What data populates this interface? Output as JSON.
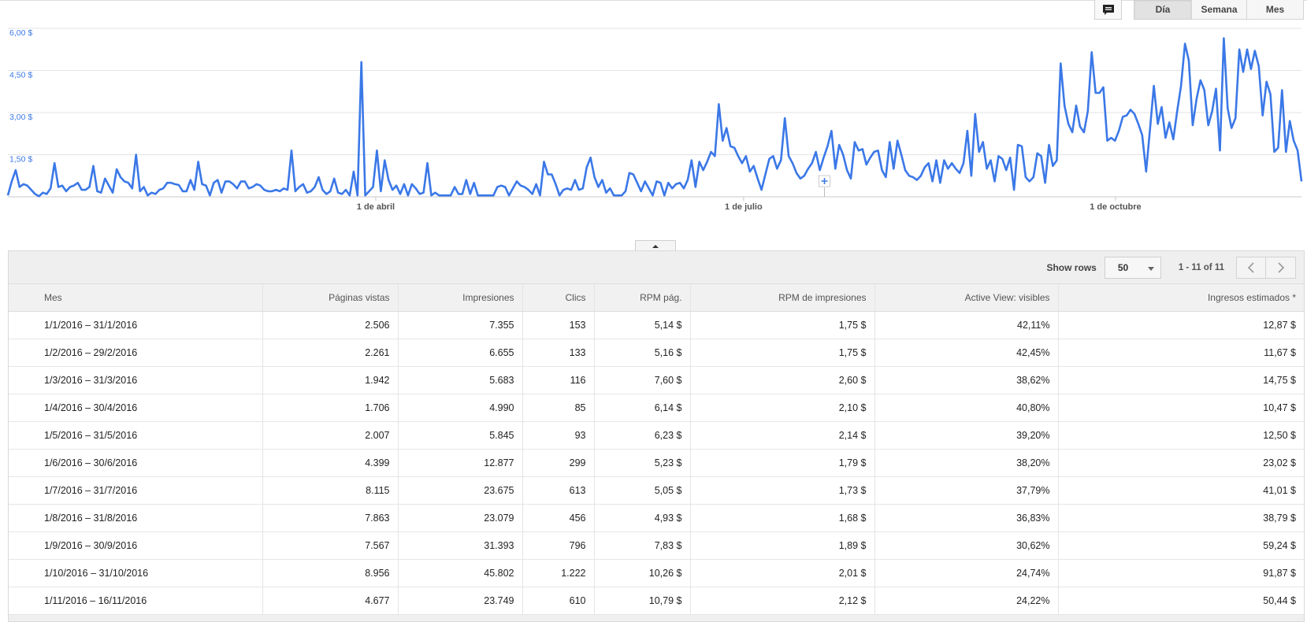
{
  "view_toggle": {
    "options": [
      "Día",
      "Semana",
      "Mes"
    ],
    "active": "Día",
    "annotation_icon": "comment-icon"
  },
  "chart_data": {
    "type": "line",
    "title": "",
    "xlabel": "",
    "ylabel": "",
    "x_start": "2016-01-01",
    "x_end": "2016-11-16",
    "x_tick_labels": [
      "1 de abril",
      "1 de julio",
      "1 de octubre"
    ],
    "y_tick_labels": [
      "1,50 $",
      "3,00 $",
      "4,50 $",
      "6,00 $"
    ],
    "ylim": [
      0,
      6
    ],
    "grid": true,
    "color": "#3b78e7",
    "series": [
      {
        "values": [
          0.05,
          0.55,
          0.95,
          0.35,
          0.45,
          0.4,
          0.25,
          0.1,
          0.02,
          0.15,
          0.1,
          0.3,
          1.2,
          0.35,
          0.4,
          0.2,
          0.35,
          0.4,
          0.5,
          0.25,
          0.25,
          0.35,
          1.1,
          0.2,
          0.15,
          0.65,
          0.4,
          0.15,
          0.98,
          0.7,
          0.55,
          0.5,
          0.3,
          1.5,
          0.2,
          0.35,
          0.05,
          0.15,
          0.1,
          0.25,
          0.3,
          0.5,
          0.5,
          0.45,
          0.42,
          0.2,
          0.2,
          0.6,
          0.25,
          1.25,
          0.45,
          0.4,
          0.05,
          0.5,
          0.6,
          0.15,
          0.55,
          0.55,
          0.45,
          0.3,
          0.55,
          0.55,
          0.3,
          0.35,
          0.45,
          0.4,
          0.25,
          0.2,
          0.2,
          0.25,
          0.2,
          0.3,
          0.25,
          1.65,
          0.2,
          0.35,
          0.45,
          0.15,
          0.2,
          0.35,
          0.7,
          0.25,
          0.1,
          0.2,
          0.65,
          0.15,
          0.1,
          0.25,
          0.05,
          0.9,
          0.05,
          4.8,
          0.05,
          0.2,
          0.35,
          1.65,
          0.2,
          1.3,
          0.6,
          0.25,
          0.4,
          0.1,
          0.45,
          0.05,
          0.45,
          0.3,
          0.1,
          0.15,
          1.2,
          0.05,
          0.15,
          0.05,
          0.05,
          0.05,
          0.05,
          0.35,
          0.1,
          0.1,
          0.6,
          0.1,
          0.5,
          0.05,
          0.05,
          0.05,
          0.05,
          0.05,
          0.35,
          0.4,
          0.35,
          0.05,
          0.3,
          0.55,
          0.4,
          0.35,
          0.25,
          0.1,
          0.45,
          0.05,
          1.25,
          0.8,
          0.8,
          0.45,
          0.05,
          0.25,
          0.3,
          0.25,
          0.6,
          0.25,
          0.3,
          1.05,
          1.4,
          0.7,
          0.35,
          0.6,
          0.15,
          0.3,
          0.05,
          0.05,
          0.05,
          0.2,
          0.85,
          0.8,
          0.5,
          0.2,
          0.55,
          0.3,
          0.05,
          0.55,
          0.5,
          0.05,
          0.5,
          0.3,
          0.45,
          0.5,
          0.3,
          0.6,
          1.3,
          0.35,
          1.25,
          0.95,
          1.25,
          1.6,
          1.45,
          3.3,
          2.0,
          2.45,
          1.8,
          1.75,
          1.45,
          1.2,
          1.45,
          0.9,
          1.1,
          0.65,
          0.25,
          0.8,
          1.35,
          1.45,
          1.0,
          1.3,
          2.8,
          1.45,
          1.2,
          0.85,
          0.65,
          0.75,
          1.0,
          1.2,
          1.6,
          0.95,
          1.4,
          1.8,
          2.35,
          1.0,
          1.85,
          1.5,
          0.95,
          0.65,
          1.95,
          1.65,
          1.7,
          1.15,
          1.4,
          1.6,
          1.65,
          0.95,
          0.7,
          1.95,
          1.0,
          2.0,
          1.5,
          0.95,
          0.75,
          0.7,
          0.6,
          0.75,
          1.05,
          1.2,
          0.55,
          1.3,
          0.5,
          1.3,
          1.0,
          1.2,
          1.0,
          0.85,
          1.2,
          2.35,
          0.75,
          2.95,
          1.6,
          1.95,
          1.0,
          1.3,
          0.55,
          1.45,
          1.35,
          0.95,
          1.4,
          0.25,
          1.85,
          1.8,
          0.7,
          0.55,
          0.7,
          1.55,
          1.45,
          0.5,
          1.85,
          1.1,
          1.3,
          4.75,
          3.25,
          2.6,
          2.3,
          3.25,
          2.5,
          2.3,
          3.05,
          5.15,
          3.7,
          3.7,
          3.9,
          2.0,
          2.1,
          2.0,
          2.35,
          2.85,
          2.9,
          3.1,
          2.95,
          2.6,
          2.2,
          0.9,
          2.4,
          3.95,
          2.6,
          3.2,
          2.1,
          2.65,
          2.05,
          3.05,
          3.95,
          5.45,
          4.85,
          2.55,
          3.5,
          4.15,
          3.8,
          2.55,
          3.05,
          3.85,
          1.65,
          5.65,
          3.15,
          2.45,
          2.8,
          5.25,
          4.45,
          5.25,
          4.55,
          5.2,
          4.65,
          2.9,
          4.1,
          3.65,
          1.6,
          1.75,
          3.8,
          1.6,
          2.7,
          2.0,
          1.65,
          0.55
        ]
      }
    ]
  },
  "table": {
    "show_rows_label": "Show rows",
    "rows_value": "50",
    "range_label": "1 - 11 of 11",
    "columns": [
      "Mes",
      "Páginas vistas",
      "Impresiones",
      "Clics",
      "RPM pág.",
      "RPM de impresiones",
      "Active View: visibles",
      "Ingresos estimados *"
    ],
    "rows": [
      [
        "1/1/2016 – 31/1/2016",
        "2.506",
        "7.355",
        "153",
        "5,14 $",
        "1,75 $",
        "42,11%",
        "12,87 $"
      ],
      [
        "1/2/2016 – 29/2/2016",
        "2.261",
        "6.655",
        "133",
        "5,16 $",
        "1,75 $",
        "42,45%",
        "11,67 $"
      ],
      [
        "1/3/2016 – 31/3/2016",
        "1.942",
        "5.683",
        "116",
        "7,60 $",
        "2,60 $",
        "38,62%",
        "14,75 $"
      ],
      [
        "1/4/2016 – 30/4/2016",
        "1.706",
        "4.990",
        "85",
        "6,14 $",
        "2,10 $",
        "40,80%",
        "10,47 $"
      ],
      [
        "1/5/2016 – 31/5/2016",
        "2.007",
        "5.845",
        "93",
        "6,23 $",
        "2,14 $",
        "39,20%",
        "12,50 $"
      ],
      [
        "1/6/2016 – 30/6/2016",
        "4.399",
        "12.877",
        "299",
        "5,23 $",
        "1,79 $",
        "38,20%",
        "23,02 $"
      ],
      [
        "1/7/2016 – 31/7/2016",
        "8.115",
        "23.675",
        "613",
        "5,05 $",
        "1,73 $",
        "37,79%",
        "41,01 $"
      ],
      [
        "1/8/2016 – 31/8/2016",
        "7.863",
        "23.079",
        "456",
        "4,93 $",
        "1,68 $",
        "36,83%",
        "38,79 $"
      ],
      [
        "1/9/2016 – 30/9/2016",
        "7.567",
        "31.393",
        "796",
        "7,83 $",
        "1,89 $",
        "30,62%",
        "59,24 $"
      ],
      [
        "1/10/2016 – 31/10/2016",
        "8.956",
        "45.802",
        "1.222",
        "10,26 $",
        "2,01 $",
        "24,74%",
        "91,87 $"
      ],
      [
        "1/11/2016 – 16/11/2016",
        "4.677",
        "23.749",
        "610",
        "10,79 $",
        "2,12 $",
        "24,22%",
        "50,44 $"
      ]
    ]
  }
}
